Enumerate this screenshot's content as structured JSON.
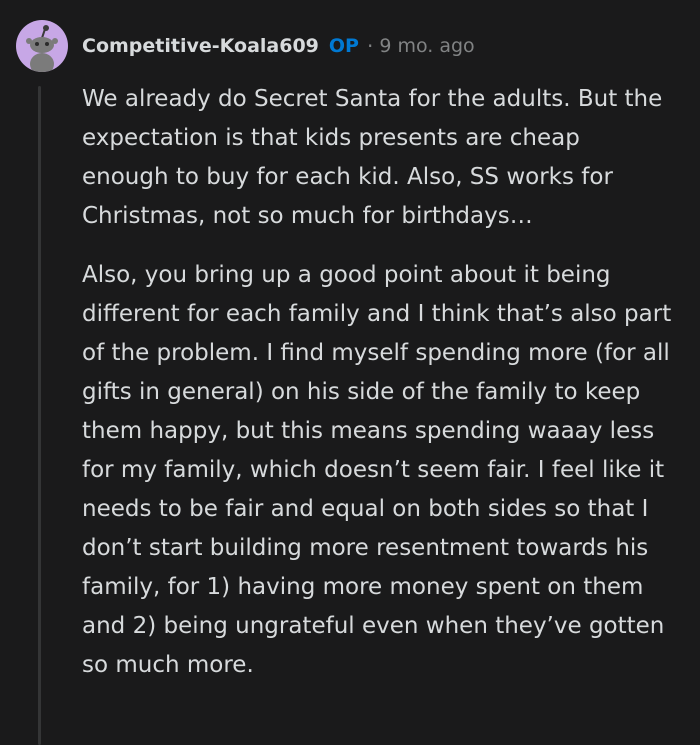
{
  "comment": {
    "username": "Competitive-Koala609",
    "op_badge": "OP",
    "separator": "·",
    "timestamp": "9 mo. ago",
    "avatar_icon": "snoo-avatar-icon",
    "colors": {
      "background": "#1a1a1b",
      "text": "#d7dadc",
      "op_badge": "#0079d3",
      "meta": "#818384",
      "avatar_bg": "#c7a7e6"
    },
    "paragraphs": [
      "We already do Secret Santa for the adults. But the expectation is that kids presents are cheap enough to buy for each kid. Also, SS works for Christmas, not so much for birthdays…",
      "Also, you bring up a good point about it being different for each family and I think that’s also part of the problem. I find myself spending more (for all gifts in general) on his side of the family to keep them happy, but this means spending waaay less for my family, which doesn’t seem fair. I feel like it needs to be fair and equal on both sides so that I don’t start building more resentment towards his family, for 1) having more money spent on them and 2) being ungrateful even when they’ve gotten so much more."
    ]
  }
}
